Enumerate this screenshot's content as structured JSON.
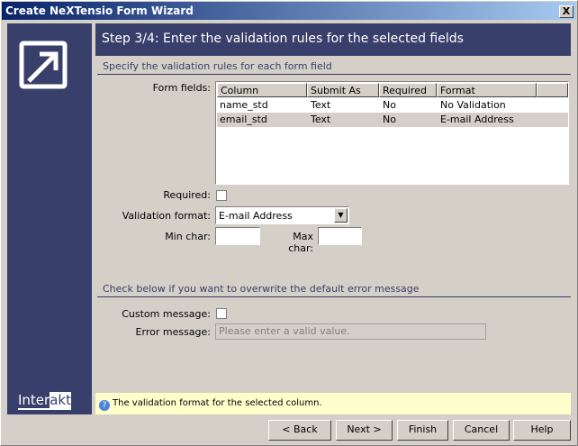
{
  "window": {
    "title": "Create NeXTensio Form Wizard",
    "close": "X"
  },
  "brand": {
    "left": "Inter",
    "right": "akt"
  },
  "header": {
    "title": "Step 3/4: Enter the validation rules for the selected fields"
  },
  "section1": {
    "title": "Specify the validation rules for each form field"
  },
  "form_fields": {
    "label": "Form fields:",
    "columns": [
      "Column",
      "Submit As",
      "Required",
      "Format"
    ],
    "rows": [
      [
        "name_std",
        "Text",
        "No",
        "No Validation"
      ],
      [
        "email_std",
        "Text",
        "No",
        "E-mail Address"
      ]
    ],
    "selected_row": 1
  },
  "required": {
    "label": "Required:",
    "checked": false
  },
  "validation_format": {
    "label": "Validation format:",
    "value": "E-mail Address"
  },
  "min_char": {
    "label": "Min char:",
    "value": ""
  },
  "max_char": {
    "label": "Max char:",
    "value": ""
  },
  "section2": {
    "title": "Check below if you want to overwrite the default error message"
  },
  "custom_message": {
    "label": "Custom message:",
    "checked": false
  },
  "error_message": {
    "label": "Error message:",
    "placeholder": "Please enter a valid value."
  },
  "info": {
    "text": "The validation format for the selected column."
  },
  "buttons": {
    "back": "< Back",
    "next": "Next >",
    "finish": "Finish",
    "cancel": "Cancel",
    "help": "Help"
  }
}
